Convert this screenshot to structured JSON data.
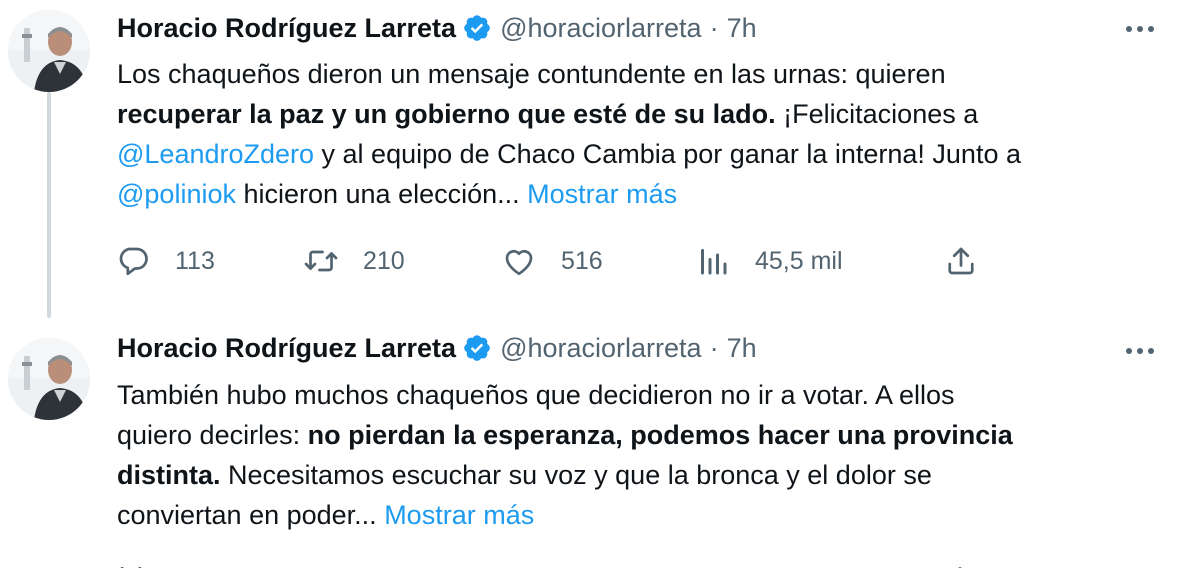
{
  "tweets": [
    {
      "author_name": "Horacio Rodríguez Larreta",
      "handle": "@horaciorlarreta",
      "separator": "·",
      "time": "7h",
      "text": {
        "l1": "Los chaqueños dieron un mensaje contundente en las urnas: quieren",
        "l2_bold": "recuperar la paz y un gobierno que esté de su lado.",
        "l2_rest": " ¡Felicitaciones a",
        "l3_mention": "@LeandroZdero",
        "l3_rest": " y al equipo de Chaco Cambia por ganar la interna! Junto a",
        "l4_mention": "@poliniok",
        "l4_rest": " hicieron una elección... ",
        "show_more": "Mostrar más"
      },
      "actions": {
        "replies": "113",
        "retweets": "210",
        "likes": "516",
        "views": "45,5 mil"
      }
    },
    {
      "author_name": "Horacio Rodríguez Larreta",
      "handle": "@horaciorlarreta",
      "separator": "·",
      "time": "7h",
      "text": {
        "l1": "También hubo muchos chaqueños que decidieron no ir a votar. A ellos",
        "l2_plain": "quiero decirles: ",
        "l2_bold": "no pierdan la esperanza, podemos hacer una provincia",
        "l3_bold": "distinta.",
        "l3_rest": " Necesitamos escuchar su voz y que la bronca y el dolor se",
        "l4_rest": "conviertan en poder... ",
        "show_more": "Mostrar más"
      }
    }
  ],
  "icons": {
    "verified": "verified-badge-icon",
    "more": "more-options-icon",
    "reply": "reply-icon",
    "retweet": "retweet-icon",
    "like": "heart-icon",
    "views": "views-icon",
    "share": "share-icon"
  },
  "colors": {
    "text": "#0f1419",
    "secondary": "#536471",
    "accent": "#1d9bf0",
    "thread_line": "#cfd9de"
  }
}
